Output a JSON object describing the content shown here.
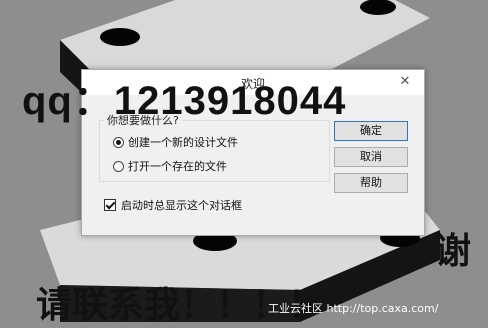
{
  "dialog": {
    "title": "欢迎",
    "close_icon": "close-icon",
    "group_label": "你想要做什么?",
    "options": [
      {
        "label": "创建一个新的设计文件",
        "selected": true
      },
      {
        "label": "打开一个存在的文件",
        "selected": false
      }
    ],
    "buttons": {
      "ok": "确定",
      "cancel": "取消",
      "help": "帮助"
    },
    "startup_checkbox": {
      "label": "启动时总显示这个对话框",
      "checked": true
    }
  },
  "overlay": {
    "qq": "qq：1213918044",
    "thanks": "谢",
    "contact": "请联系我！！！！",
    "footer": "工业云社区 http://top.caxa.com/"
  },
  "colors": {
    "accent": "#2b75d0",
    "background": "#8e8e8e"
  }
}
